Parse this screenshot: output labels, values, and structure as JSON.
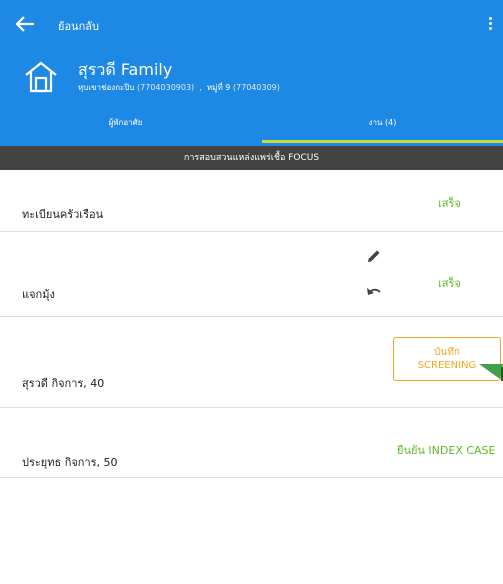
{
  "appbar": {
    "back_label": "ย้อนกลับ",
    "family_name": "สุรวดี Family",
    "village": "หุบเขาช่องกะปิบ",
    "village_code": "(7704030903)",
    "separator": ",",
    "moo": "หมู่ที่ 9",
    "moo_code": "(77040309)"
  },
  "tabs": [
    {
      "label": "ผู้พักอาศัย"
    },
    {
      "label": "งาน (4)"
    }
  ],
  "banner": "การสอบสวนแหล่งแพร่เชื้อ FOCUS",
  "rows": [
    {
      "label": "ทะเบียนครัวเรือน",
      "status": "เสร็จ"
    },
    {
      "label": "แจกมุ้ง",
      "status": "เสร็จ"
    },
    {
      "label": "สุรวดี  กิจการ, 40",
      "button_line1": "บันทึก",
      "button_line2": "SCREENING"
    },
    {
      "label": "ประยุทธ  กิจการ, 50",
      "action": "ยืนยัน INDEX CASE"
    }
  ],
  "colors": {
    "primary": "#1e88e5",
    "accent_tab": "#cddc39",
    "banner_bg": "#424242",
    "done_green": "#5fb924",
    "screening_orange": "#f5a623",
    "flag_green": "#43a047"
  }
}
